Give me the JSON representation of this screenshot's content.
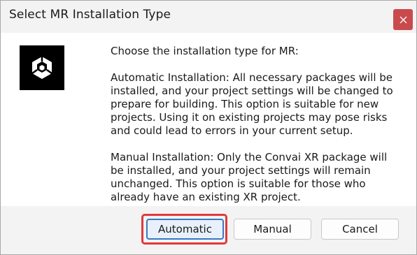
{
  "window": {
    "title": "Select MR Installation Type",
    "close_glyph": "✕"
  },
  "logo": {
    "icon": "unity-logo-icon"
  },
  "message": {
    "intro": "Choose the installation type for MR:",
    "automatic": "Automatic Installation: All necessary packages will be\ninstalled, and your project settings will be changed to\nprepare for building. This option is suitable for new\nprojects. Using it on existing projects may pose risks\nand could lead to errors in your current setup.",
    "manual": "Manual Installation: Only the Convai XR package will\nbe installed, and your project settings will remain\nunchanged. This option is suitable for those who\nalready have an existing XR project."
  },
  "buttons": {
    "automatic": "Automatic",
    "manual": "Manual",
    "cancel": "Cancel"
  },
  "colors": {
    "close_button": "#c94a4d",
    "highlight_outline": "#e0393f",
    "default_button_border": "#3a78c4"
  }
}
